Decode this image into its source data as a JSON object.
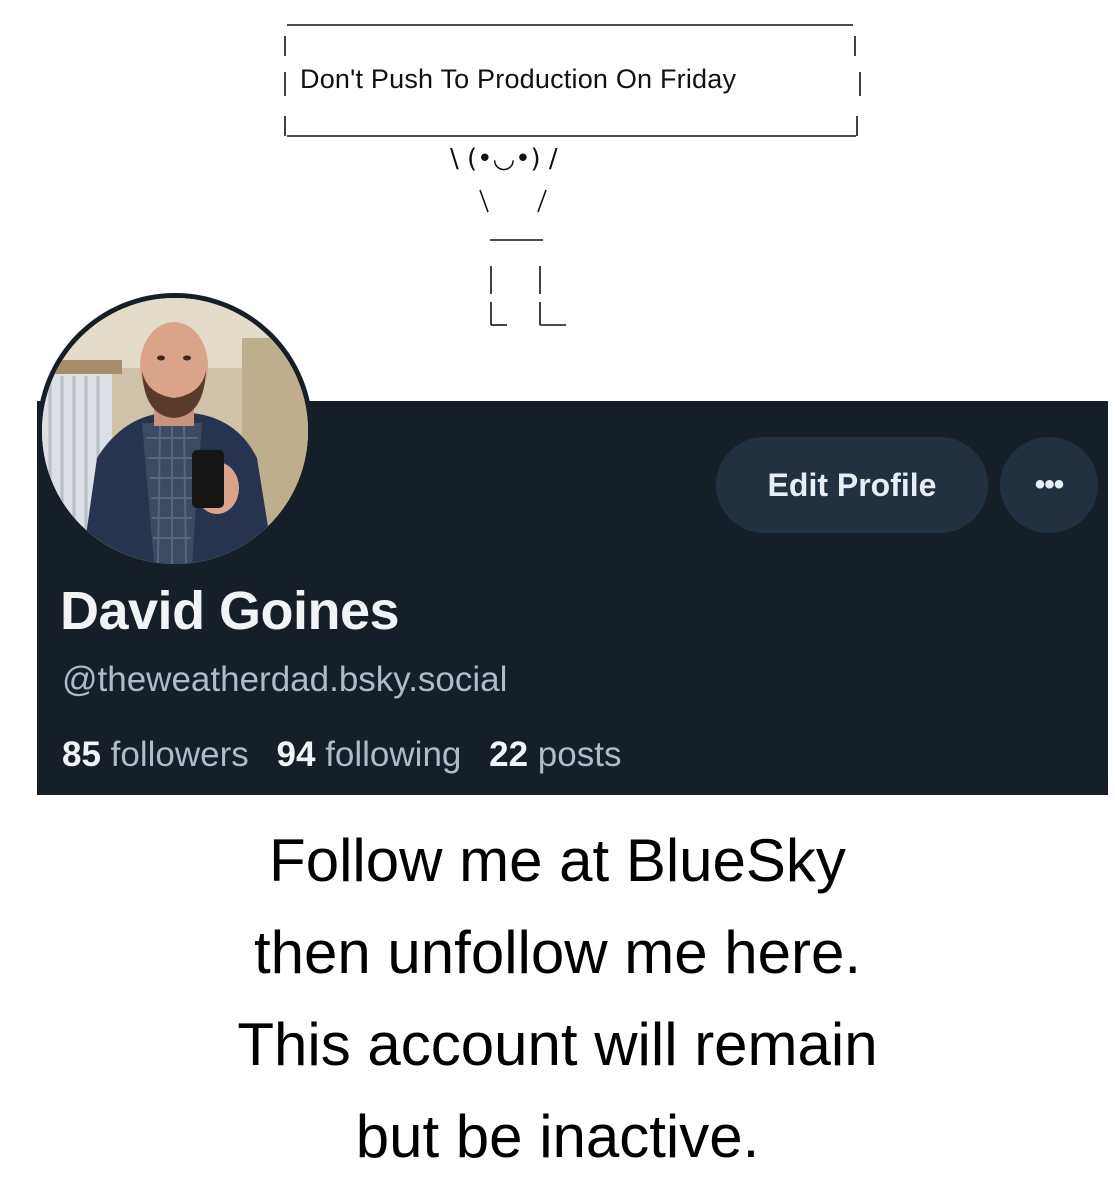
{
  "sign": {
    "text": "Don't Push To Production On Friday",
    "face": "\\ (•◡•) /"
  },
  "profile": {
    "display_name": "David Goines",
    "handle": "@theweatherdad.bsky.social",
    "edit_button_label": "Edit Profile",
    "more_button_label": "•••",
    "stats": {
      "followers_count": "85",
      "followers_label": "followers",
      "following_count": "94",
      "following_label": "following",
      "posts_count": "22",
      "posts_label": "posts"
    }
  },
  "message": {
    "line1": "Follow me at BlueSky",
    "line2": "then unfollow me here.",
    "line3": "This account will remain",
    "line4": "but be inactive."
  },
  "colors": {
    "card_background": "#161e27",
    "button_background": "#233040",
    "primary_text": "#f1f3f5",
    "secondary_text": "#aebbc9"
  }
}
